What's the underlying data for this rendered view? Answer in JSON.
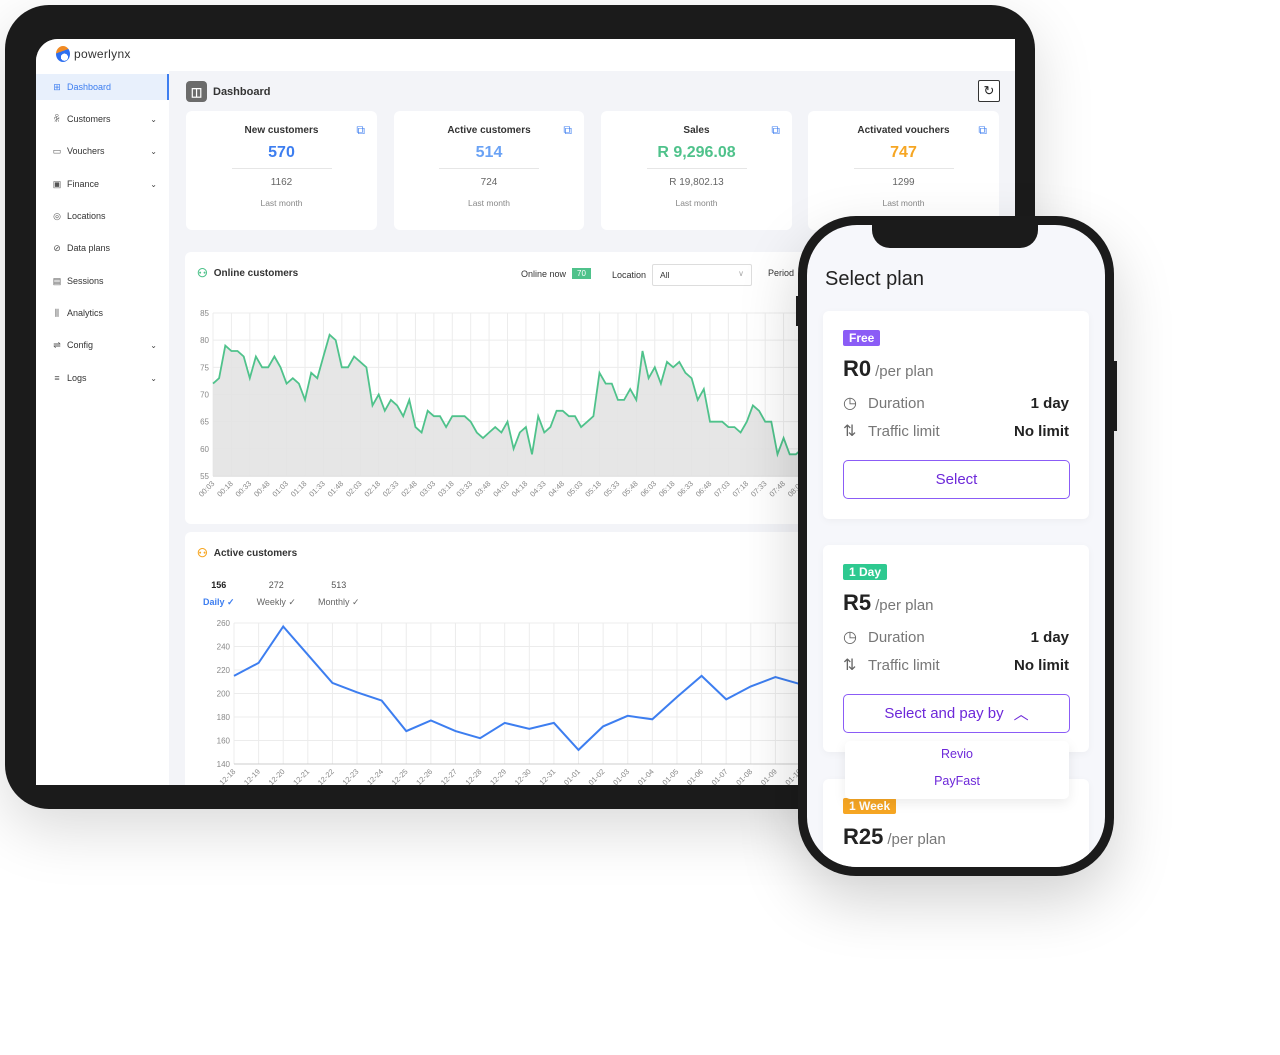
{
  "app": {
    "brand": "powerlynx"
  },
  "sidebar": {
    "items": [
      {
        "label": "Dashboard",
        "icon": "dashboard-icon",
        "active": true,
        "expandable": false
      },
      {
        "label": "Customers",
        "icon": "users-icon",
        "expandable": true
      },
      {
        "label": "Vouchers",
        "icon": "ticket-icon",
        "expandable": true
      },
      {
        "label": "Finance",
        "icon": "money-icon",
        "expandable": true
      },
      {
        "label": "Locations",
        "icon": "location-pin-icon",
        "expandable": false
      },
      {
        "label": "Data plans",
        "icon": "data-plan-icon",
        "expandable": false
      },
      {
        "label": "Sessions",
        "icon": "sessions-icon",
        "expandable": false
      },
      {
        "label": "Analytics",
        "icon": "bar-chart-icon",
        "expandable": false
      },
      {
        "label": "Config",
        "icon": "sliders-icon",
        "expandable": true
      },
      {
        "label": "Logs",
        "icon": "list-icon",
        "expandable": true
      }
    ]
  },
  "header": {
    "title": "Dashboard"
  },
  "cards": [
    {
      "title": "New customers",
      "value": "570",
      "previous": "1162",
      "sub": "Last month",
      "color": "#3d7ef0"
    },
    {
      "title": "Active customers",
      "value": "514",
      "previous": "724",
      "sub": "Last month",
      "color": "#6aa2f5"
    },
    {
      "title": "Sales",
      "value": "R 9,296.08",
      "previous": "R 19,802.13",
      "sub": "Last month",
      "color": "#4fc28b"
    },
    {
      "title": "Activated vouchers",
      "value": "747",
      "previous": "1299",
      "sub": "Last month",
      "color": "#f6a623"
    }
  ],
  "online": {
    "title": "Online customers",
    "online_now_label": "Online now",
    "online_now": "70",
    "location_label": "Location",
    "location_value": "All",
    "period_label": "Period"
  },
  "active": {
    "title": "Active customers",
    "tabs": [
      {
        "count": "156",
        "label": "Daily ✓",
        "active": true
      },
      {
        "count": "272",
        "label": "Weekly ✓"
      },
      {
        "count": "513",
        "label": "Monthly ✓"
      }
    ]
  },
  "chart_data": [
    {
      "type": "area",
      "title": "Online customers",
      "ylim": [
        55,
        85
      ],
      "yticks": [
        "85",
        "80",
        "75",
        "70",
        "65",
        "60",
        "55"
      ],
      "xticks": [
        "00:03",
        "00:18",
        "00:33",
        "00:48",
        "01:03",
        "01:18",
        "01:33",
        "01:48",
        "02:03",
        "02:18",
        "02:33",
        "02:48",
        "03:03",
        "03:18",
        "03:33",
        "03:48",
        "04:03",
        "04:18",
        "04:33",
        "04:48",
        "05:03",
        "05:18",
        "05:33",
        "05:48",
        "06:03",
        "06:18",
        "06:33",
        "06:48",
        "07:03",
        "07:18",
        "07:33",
        "07:48",
        "08:03"
      ],
      "x_interval_minutes": 5,
      "values": [
        72,
        73,
        79,
        78,
        78,
        77,
        73,
        77,
        75,
        75,
        77,
        75,
        72,
        73,
        72,
        69,
        74,
        73,
        77,
        81,
        80,
        75,
        75,
        77,
        76,
        75,
        68,
        70,
        67,
        69,
        68,
        66,
        69,
        64,
        63,
        67,
        66,
        66,
        64,
        66,
        66,
        66,
        65,
        63,
        62,
        63,
        64,
        63,
        65,
        60,
        63,
        64,
        59,
        66,
        63,
        64,
        67,
        67,
        66,
        66,
        64,
        65,
        66,
        74,
        72,
        72,
        69,
        69,
        71,
        69,
        78,
        73,
        75,
        72,
        76,
        75,
        76,
        74,
        73,
        69,
        71,
        65,
        65,
        65,
        64,
        64,
        63,
        65,
        68,
        67,
        65,
        65,
        59,
        62,
        59,
        59,
        60
      ],
      "line_color": "#4fc28b",
      "fill_color": "#e3e3e3",
      "grid": true
    },
    {
      "type": "line",
      "title": "Active customers",
      "ylim": [
        140,
        260
      ],
      "yticks": [
        "260",
        "240",
        "220",
        "200",
        "180",
        "160",
        "140"
      ],
      "categories": [
        "12-18",
        "12-19",
        "12-20",
        "12-21",
        "12-22",
        "12-23",
        "12-24",
        "12-25",
        "12-26",
        "12-27",
        "12-28",
        "12-29",
        "12-30",
        "12-31",
        "01-01",
        "01-02",
        "01-03",
        "01-04",
        "01-05",
        "01-06",
        "01-07",
        "01-08",
        "01-09",
        "01-10"
      ],
      "values": [
        215,
        226,
        257,
        233,
        209,
        201,
        194,
        168,
        177,
        168,
        162,
        175,
        170,
        175,
        152,
        172,
        181,
        178,
        197,
        215,
        195,
        206,
        214,
        208
      ],
      "line_color": "#3d7ef0",
      "grid": true
    }
  ],
  "phone": {
    "title": "Select plan",
    "plans": [
      {
        "badge": "Free",
        "badge_color": "#8b5cf6",
        "price": "R0",
        "unit": "/per plan",
        "duration_label": "Duration",
        "duration": "1 day",
        "traffic_label": "Traffic limit",
        "traffic": "No limit",
        "button": "Select"
      },
      {
        "badge": "1 Day",
        "badge_color": "#2ec990",
        "price": "R5",
        "unit": "/per plan",
        "duration_label": "Duration",
        "duration": "1 day",
        "traffic_label": "Traffic limit",
        "traffic": "No limit",
        "button": "Select and pay by"
      },
      {
        "badge": "1 Week",
        "badge_color": "#f6a623",
        "price": "R25",
        "unit": "/per plan"
      }
    ],
    "pay_options": [
      "Revio",
      "PayFast"
    ]
  }
}
